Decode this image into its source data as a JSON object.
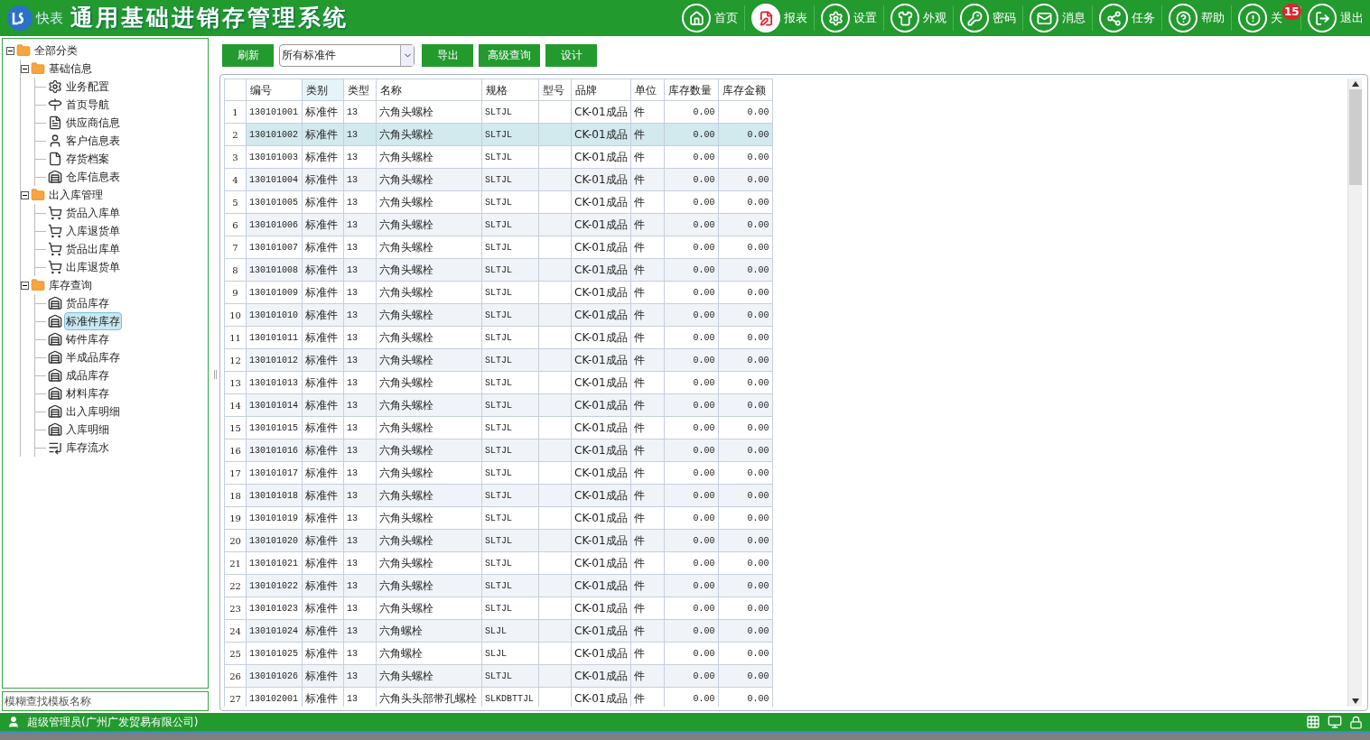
{
  "header": {
    "logo_text": "快表",
    "title": "通用基础进销存管理系统",
    "nav": [
      {
        "kind": "home",
        "label": "首页"
      },
      {
        "kind": "report",
        "label": "报表"
      },
      {
        "kind": "settings",
        "label": "设置"
      },
      {
        "kind": "appearance",
        "label": "外观"
      },
      {
        "kind": "password",
        "label": "密码"
      },
      {
        "kind": "message",
        "label": "消息"
      },
      {
        "kind": "task",
        "label": "任务"
      },
      {
        "kind": "help",
        "label": "帮助"
      },
      {
        "kind": "about",
        "label": "关",
        "badge": "15"
      },
      {
        "kind": "exit",
        "label": "退出"
      }
    ]
  },
  "sidebar": {
    "tree": [
      {
        "label": "全部分类",
        "kind": "folder",
        "expanded": true,
        "selected": false,
        "children": [
          {
            "label": "基础信息",
            "kind": "folder",
            "expanded": true,
            "selected": false,
            "children": [
              {
                "label": "业务配置",
                "kind": "gear",
                "selected": false
              },
              {
                "label": "首页导航",
                "kind": "signpost",
                "selected": false
              },
              {
                "label": "供应商信息",
                "kind": "doc",
                "selected": false
              },
              {
                "label": "客户信息表",
                "kind": "user",
                "selected": false
              },
              {
                "label": "存货档案",
                "kind": "file",
                "selected": false
              },
              {
                "label": "仓库信息表",
                "kind": "warehouse",
                "selected": false
              }
            ]
          },
          {
            "label": "出入库管理",
            "kind": "folder",
            "expanded": true,
            "selected": false,
            "children": [
              {
                "label": "货品入库单",
                "kind": "cart",
                "selected": false
              },
              {
                "label": "入库退货单",
                "kind": "cart",
                "selected": false
              },
              {
                "label": "货品出库单",
                "kind": "cart",
                "selected": false
              },
              {
                "label": "出库退货单",
                "kind": "cart",
                "selected": false
              }
            ]
          },
          {
            "label": "库存查询",
            "kind": "folder",
            "expanded": true,
            "selected": false,
            "children": [
              {
                "label": "货品库存",
                "kind": "store",
                "selected": false
              },
              {
                "label": "标准件库存",
                "kind": "store",
                "selected": true
              },
              {
                "label": "铸件库存",
                "kind": "store",
                "selected": false
              },
              {
                "label": "半成品库存",
                "kind": "store",
                "selected": false
              },
              {
                "label": "成品库存",
                "kind": "store",
                "selected": false
              },
              {
                "label": "材料库存",
                "kind": "store",
                "selected": false
              },
              {
                "label": "出入库明细",
                "kind": "store",
                "selected": false
              },
              {
                "label": "入库明细",
                "kind": "store",
                "selected": false
              },
              {
                "label": "库存流水",
                "kind": "list",
                "selected": false
              }
            ]
          }
        ]
      }
    ],
    "search": {
      "placeholder": "模糊查找模板名称"
    }
  },
  "toolbar": {
    "refresh": "刷新",
    "filter": "所有标准件",
    "export": "导出",
    "advanced": "高级查询",
    "design": "设计"
  },
  "table": {
    "columns": [
      "编号",
      "类别",
      "类型",
      "名称",
      "规格",
      "型号",
      "品牌",
      "单位",
      "库存数量",
      "库存金额"
    ],
    "rows": [
      {
        "n": "1",
        "cells": [
          "130101001",
          "标准件",
          "13",
          "六角头螺栓",
          "SLTJL",
          "",
          "CK-01成品",
          "件",
          "0.00",
          "0.00"
        ],
        "selected": false
      },
      {
        "n": "2",
        "cells": [
          "130101002",
          "标准件",
          "13",
          "六角头螺栓",
          "SLTJL",
          "",
          "CK-01成品",
          "件",
          "0.00",
          "0.00"
        ],
        "selected": true
      },
      {
        "n": "3",
        "cells": [
          "130101003",
          "标准件",
          "13",
          "六角头螺栓",
          "SLTJL",
          "",
          "CK-01成品",
          "件",
          "0.00",
          "0.00"
        ],
        "selected": false
      },
      {
        "n": "4",
        "cells": [
          "130101004",
          "标准件",
          "13",
          "六角头螺栓",
          "SLTJL",
          "",
          "CK-01成品",
          "件",
          "0.00",
          "0.00"
        ],
        "selected": false
      },
      {
        "n": "5",
        "cells": [
          "130101005",
          "标准件",
          "13",
          "六角头螺栓",
          "SLTJL",
          "",
          "CK-01成品",
          "件",
          "0.00",
          "0.00"
        ],
        "selected": false
      },
      {
        "n": "6",
        "cells": [
          "130101006",
          "标准件",
          "13",
          "六角头螺栓",
          "SLTJL",
          "",
          "CK-01成品",
          "件",
          "0.00",
          "0.00"
        ],
        "selected": false
      },
      {
        "n": "7",
        "cells": [
          "130101007",
          "标准件",
          "13",
          "六角头螺栓",
          "SLTJL",
          "",
          "CK-01成品",
          "件",
          "0.00",
          "0.00"
        ],
        "selected": false
      },
      {
        "n": "8",
        "cells": [
          "130101008",
          "标准件",
          "13",
          "六角头螺栓",
          "SLTJL",
          "",
          "CK-01成品",
          "件",
          "0.00",
          "0.00"
        ],
        "selected": false
      },
      {
        "n": "9",
        "cells": [
          "130101009",
          "标准件",
          "13",
          "六角头螺栓",
          "SLTJL",
          "",
          "CK-01成品",
          "件",
          "0.00",
          "0.00"
        ],
        "selected": false
      },
      {
        "n": "10",
        "cells": [
          "130101010",
          "标准件",
          "13",
          "六角头螺栓",
          "SLTJL",
          "",
          "CK-01成品",
          "件",
          "0.00",
          "0.00"
        ],
        "selected": false
      },
      {
        "n": "11",
        "cells": [
          "130101011",
          "标准件",
          "13",
          "六角头螺栓",
          "SLTJL",
          "",
          "CK-01成品",
          "件",
          "0.00",
          "0.00"
        ],
        "selected": false
      },
      {
        "n": "12",
        "cells": [
          "130101012",
          "标准件",
          "13",
          "六角头螺栓",
          "SLTJL",
          "",
          "CK-01成品",
          "件",
          "0.00",
          "0.00"
        ],
        "selected": false
      },
      {
        "n": "13",
        "cells": [
          "130101013",
          "标准件",
          "13",
          "六角头螺栓",
          "SLTJL",
          "",
          "CK-01成品",
          "件",
          "0.00",
          "0.00"
        ],
        "selected": false
      },
      {
        "n": "14",
        "cells": [
          "130101014",
          "标准件",
          "13",
          "六角头螺栓",
          "SLTJL",
          "",
          "CK-01成品",
          "件",
          "0.00",
          "0.00"
        ],
        "selected": false
      },
      {
        "n": "15",
        "cells": [
          "130101015",
          "标准件",
          "13",
          "六角头螺栓",
          "SLTJL",
          "",
          "CK-01成品",
          "件",
          "0.00",
          "0.00"
        ],
        "selected": false
      },
      {
        "n": "16",
        "cells": [
          "130101016",
          "标准件",
          "13",
          "六角头螺栓",
          "SLTJL",
          "",
          "CK-01成品",
          "件",
          "0.00",
          "0.00"
        ],
        "selected": false
      },
      {
        "n": "17",
        "cells": [
          "130101017",
          "标准件",
          "13",
          "六角头螺栓",
          "SLTJL",
          "",
          "CK-01成品",
          "件",
          "0.00",
          "0.00"
        ],
        "selected": false
      },
      {
        "n": "18",
        "cells": [
          "130101018",
          "标准件",
          "13",
          "六角头螺栓",
          "SLTJL",
          "",
          "CK-01成品",
          "件",
          "0.00",
          "0.00"
        ],
        "selected": false
      },
      {
        "n": "19",
        "cells": [
          "130101019",
          "标准件",
          "13",
          "六角头螺栓",
          "SLTJL",
          "",
          "CK-01成品",
          "件",
          "0.00",
          "0.00"
        ],
        "selected": false
      },
      {
        "n": "20",
        "cells": [
          "130101020",
          "标准件",
          "13",
          "六角头螺栓",
          "SLTJL",
          "",
          "CK-01成品",
          "件",
          "0.00",
          "0.00"
        ],
        "selected": false
      },
      {
        "n": "21",
        "cells": [
          "130101021",
          "标准件",
          "13",
          "六角头螺栓",
          "SLTJL",
          "",
          "CK-01成品",
          "件",
          "0.00",
          "0.00"
        ],
        "selected": false
      },
      {
        "n": "22",
        "cells": [
          "130101022",
          "标准件",
          "13",
          "六角头螺栓",
          "SLTJL",
          "",
          "CK-01成品",
          "件",
          "0.00",
          "0.00"
        ],
        "selected": false
      },
      {
        "n": "23",
        "cells": [
          "130101023",
          "标准件",
          "13",
          "六角头螺栓",
          "SLTJL",
          "",
          "CK-01成品",
          "件",
          "0.00",
          "0.00"
        ],
        "selected": false
      },
      {
        "n": "24",
        "cells": [
          "130101024",
          "标准件",
          "13",
          "六角螺栓",
          "SLJL",
          "",
          "CK-01成品",
          "件",
          "0.00",
          "0.00"
        ],
        "selected": false
      },
      {
        "n": "25",
        "cells": [
          "130101025",
          "标准件",
          "13",
          "六角螺栓",
          "SLJL",
          "",
          "CK-01成品",
          "件",
          "0.00",
          "0.00"
        ],
        "selected": false
      },
      {
        "n": "26",
        "cells": [
          "130101026",
          "标准件",
          "13",
          "六角头螺栓",
          "SLTJL",
          "",
          "CK-01成品",
          "件",
          "0.00",
          "0.00"
        ],
        "selected": false
      },
      {
        "n": "27",
        "cells": [
          "130102001",
          "标准件",
          "13",
          "六角头头部带孔螺栓",
          "SLKDBTTJL",
          "",
          "CK-01成品",
          "件",
          "0.00",
          "0.00"
        ],
        "selected": false
      }
    ]
  },
  "status_bar": {
    "user": "超级管理员(广州广发贸易有限公司)"
  }
}
